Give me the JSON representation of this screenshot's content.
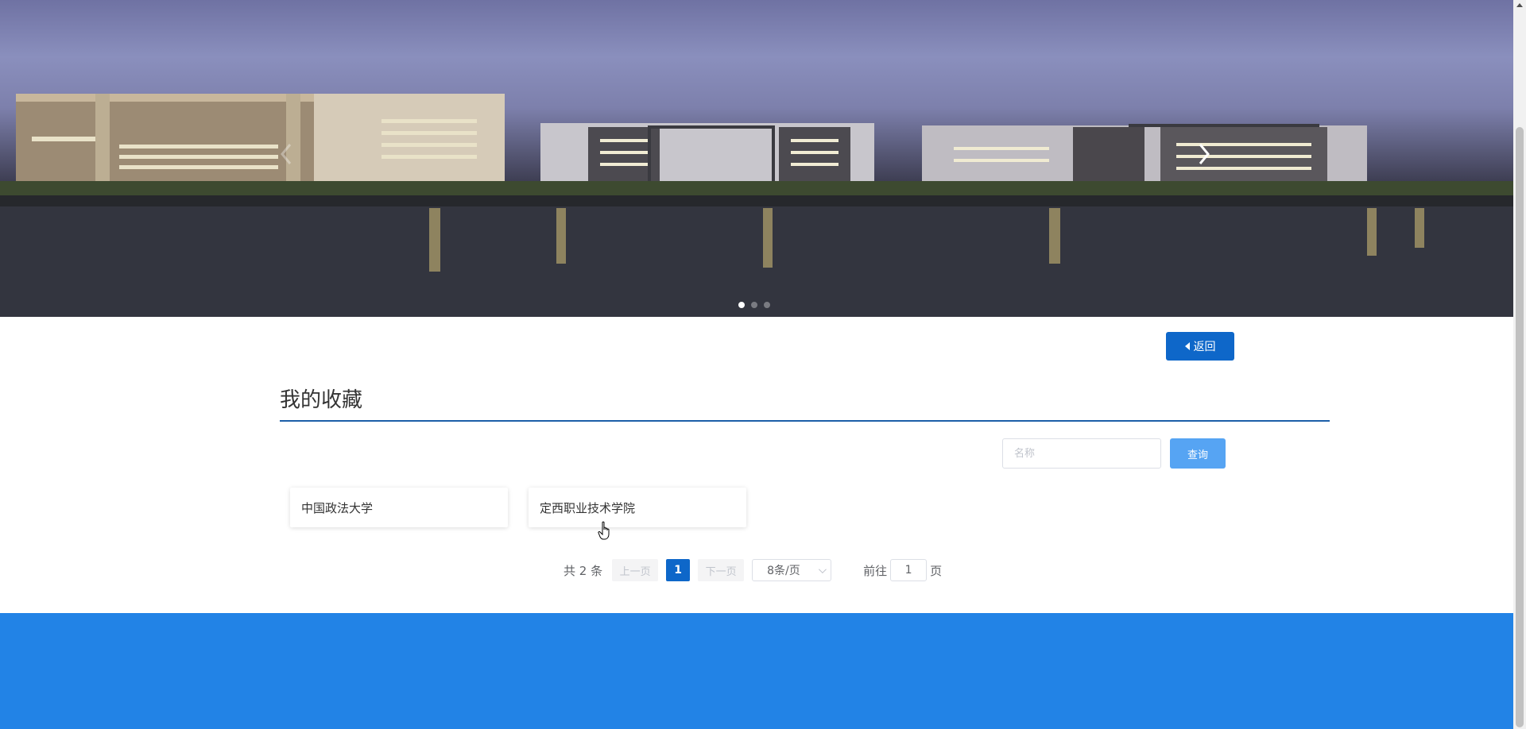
{
  "banner": {
    "image_icon": "campus-night-lake-photo",
    "prev_icon": "chevron-left-icon",
    "next_icon": "chevron-right-icon",
    "slides": 3,
    "active_slide": 1
  },
  "back_button": {
    "icon": "caret-left-icon",
    "label": "返回"
  },
  "section": {
    "title": "我的收藏"
  },
  "search": {
    "placeholder": "名称",
    "value": "",
    "button_label": "查询"
  },
  "favorites": [
    {
      "name": "中国政法大学"
    },
    {
      "name": "定西职业技术学院"
    }
  ],
  "pagination": {
    "total_text": "共 2 条",
    "prev_label": "上一页",
    "current_page": "1",
    "next_label": "下一页",
    "page_size": "8条/页",
    "goto_label": "前往",
    "goto_value": "1",
    "page_suffix": "页"
  },
  "colors": {
    "primary": "#0e67c9",
    "search_button": "#56a4f3",
    "footer": "#2283e6",
    "rule": "#1c5fa8"
  }
}
